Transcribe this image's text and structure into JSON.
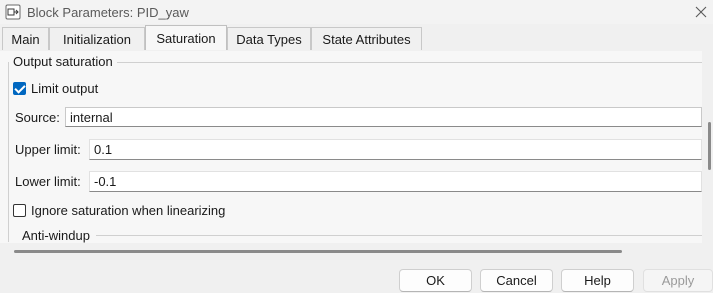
{
  "window": {
    "title": "Block Parameters: PID_yaw",
    "icon": "block-parameters-icon",
    "close_icon": "close-icon"
  },
  "tabs": [
    {
      "label": "Main",
      "active": false
    },
    {
      "label": "Initialization",
      "active": false
    },
    {
      "label": "Saturation",
      "active": true
    },
    {
      "label": "Data Types",
      "active": false
    },
    {
      "label": "State Attributes",
      "active": false
    }
  ],
  "output_saturation": {
    "title": "Output saturation",
    "limit_output": {
      "label": "Limit output",
      "checked": true
    },
    "source": {
      "label": "Source:",
      "value": "internal"
    },
    "upper_limit": {
      "label": "Upper limit:",
      "value": "0.1"
    },
    "lower_limit": {
      "label": "Lower limit:",
      "value": "-0.1"
    },
    "ignore_saturation": {
      "label": "Ignore saturation when linearizing",
      "checked": false
    }
  },
  "anti_windup": {
    "title": "Anti-windup"
  },
  "buttons": {
    "ok": "OK",
    "cancel": "Cancel",
    "help": "Help",
    "apply": "Apply"
  },
  "colors": {
    "accent": "#0067c0",
    "background": "#f0f0f0"
  }
}
